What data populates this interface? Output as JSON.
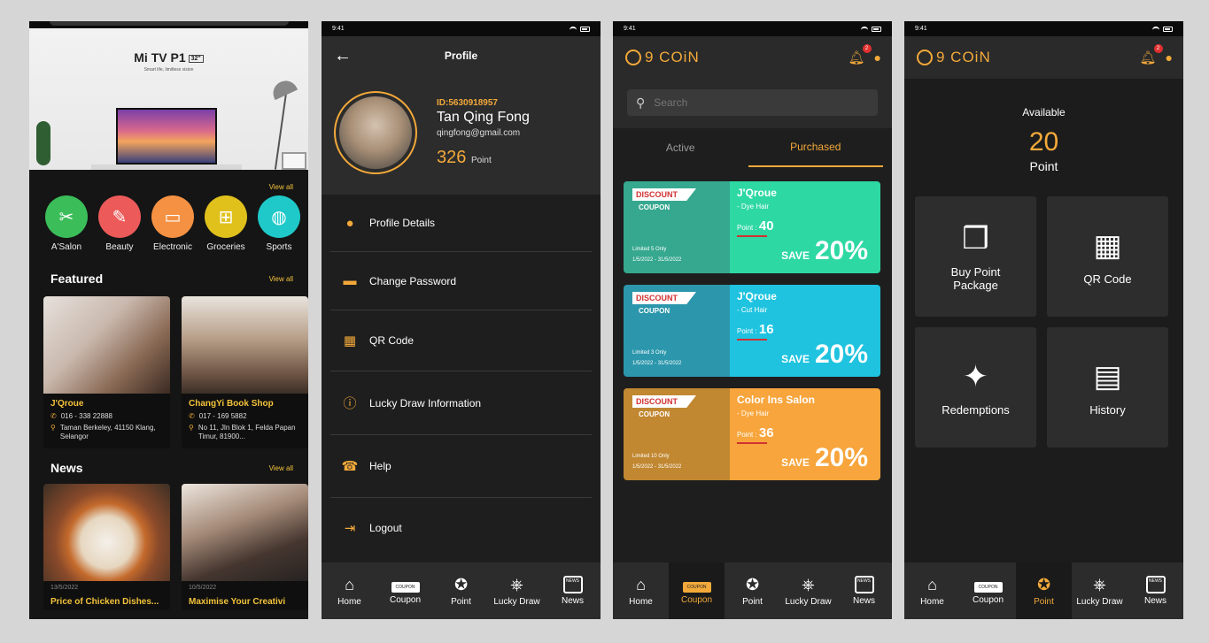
{
  "status": {
    "time": "9:41"
  },
  "home": {
    "banner_title": "Mi TV P1",
    "banner_badge": "32\"",
    "banner_subtitle": "Smart life, limitless vision",
    "view_all": "View all",
    "categories": [
      {
        "label": "A'Salon",
        "icon": "✂",
        "color": "#3bbd5a"
      },
      {
        "label": "Beauty",
        "icon": "✎",
        "color": "#ec5a5a"
      },
      {
        "label": "Electronic",
        "icon": "▭",
        "color": "#f59142"
      },
      {
        "label": "Groceries",
        "icon": "⊞",
        "color": "#e0c11c"
      },
      {
        "label": "Sports",
        "icon": "◍",
        "color": "#1fc9c9"
      }
    ],
    "featured_title": "Featured",
    "featured": [
      {
        "name": "J'Qroue",
        "phone": "016 - 338 22888",
        "address": "Taman Berkeley, 41150 Klang, Selangor",
        "img_color": "#d9cfc4"
      },
      {
        "name": "ChangYi Book Shop",
        "phone": "017 - 169 5882",
        "address": "No 11, Jln Blok 1, Felda Papan Timur, 81900...",
        "img_color": "#b9a58e"
      }
    ],
    "news_title": "News",
    "news": [
      {
        "date": "13/5/2022",
        "title": "Price of Chicken Dishes..."
      },
      {
        "date": "10/5/2022",
        "title": "Maximise Your Creativi"
      }
    ]
  },
  "profile": {
    "title": "Profile",
    "id": "ID:5630918957",
    "name": "Tan Qing Fong",
    "email": "qingfong@gmail.com",
    "points": "326",
    "points_unit": "Point",
    "menu": [
      {
        "label": "Profile Details",
        "icon": "●"
      },
      {
        "label": "Change Password",
        "icon": "▬"
      },
      {
        "label": "QR Code",
        "icon": "▦"
      },
      {
        "label": "Lucky Draw Information",
        "icon": "ⓘ"
      },
      {
        "label": "Help",
        "icon": "☎"
      },
      {
        "label": "Logout",
        "icon": "⇥"
      }
    ]
  },
  "nav": {
    "home": "Home",
    "coupon": "Coupon",
    "point": "Point",
    "lucky": "Lucky Draw",
    "news": "News",
    "coupon_icon_text": "COUPON",
    "news_icon_text": "NEWS"
  },
  "header": {
    "logo": "9 COiN",
    "badge": "2"
  },
  "coupons_page": {
    "search_placeholder": "Search",
    "tab_active": "Active",
    "tab_purchased": "Purchased",
    "discount_label": "DISCOUNT",
    "coupon_label": "COUPON",
    "items": [
      {
        "name": "J'Qroue",
        "service": "- Dye Hair",
        "point_label": "Point :",
        "point": "40",
        "limit": "Limited 5 Only",
        "dates": "1/5/2022 - 31/5/2022",
        "save_label": "SAVE",
        "save": "20%",
        "color_left": "#36a88f",
        "color_right": "#2ed8a3"
      },
      {
        "name": "J'Qroue",
        "service": "- Cut Hair",
        "point_label": "Point :",
        "point": "16",
        "limit": "Limited 3 Only",
        "dates": "1/5/2022 - 31/5/2022",
        "save_label": "SAVE",
        "save": "20%",
        "color_left": "#2c97ac",
        "color_right": "#1fc3df"
      },
      {
        "name": "Color Ins Salon",
        "service": "- Dye Hair",
        "point_label": "Point :",
        "point": "36",
        "limit": "Limited 10 Only",
        "dates": "1/5/2022 - 31/5/2022",
        "save_label": "SAVE",
        "save": "20%",
        "color_left": "#c18731",
        "color_right": "#f7a53c"
      }
    ]
  },
  "point_page": {
    "available_label": "Available",
    "available_value": "20",
    "unit": "Point",
    "tiles": [
      {
        "label": "Buy Point Package",
        "icon": "❒"
      },
      {
        "label": "QR Code",
        "icon": "▦"
      },
      {
        "label": "Redemptions",
        "icon": "✦"
      },
      {
        "label": "History",
        "icon": "▤"
      }
    ]
  }
}
